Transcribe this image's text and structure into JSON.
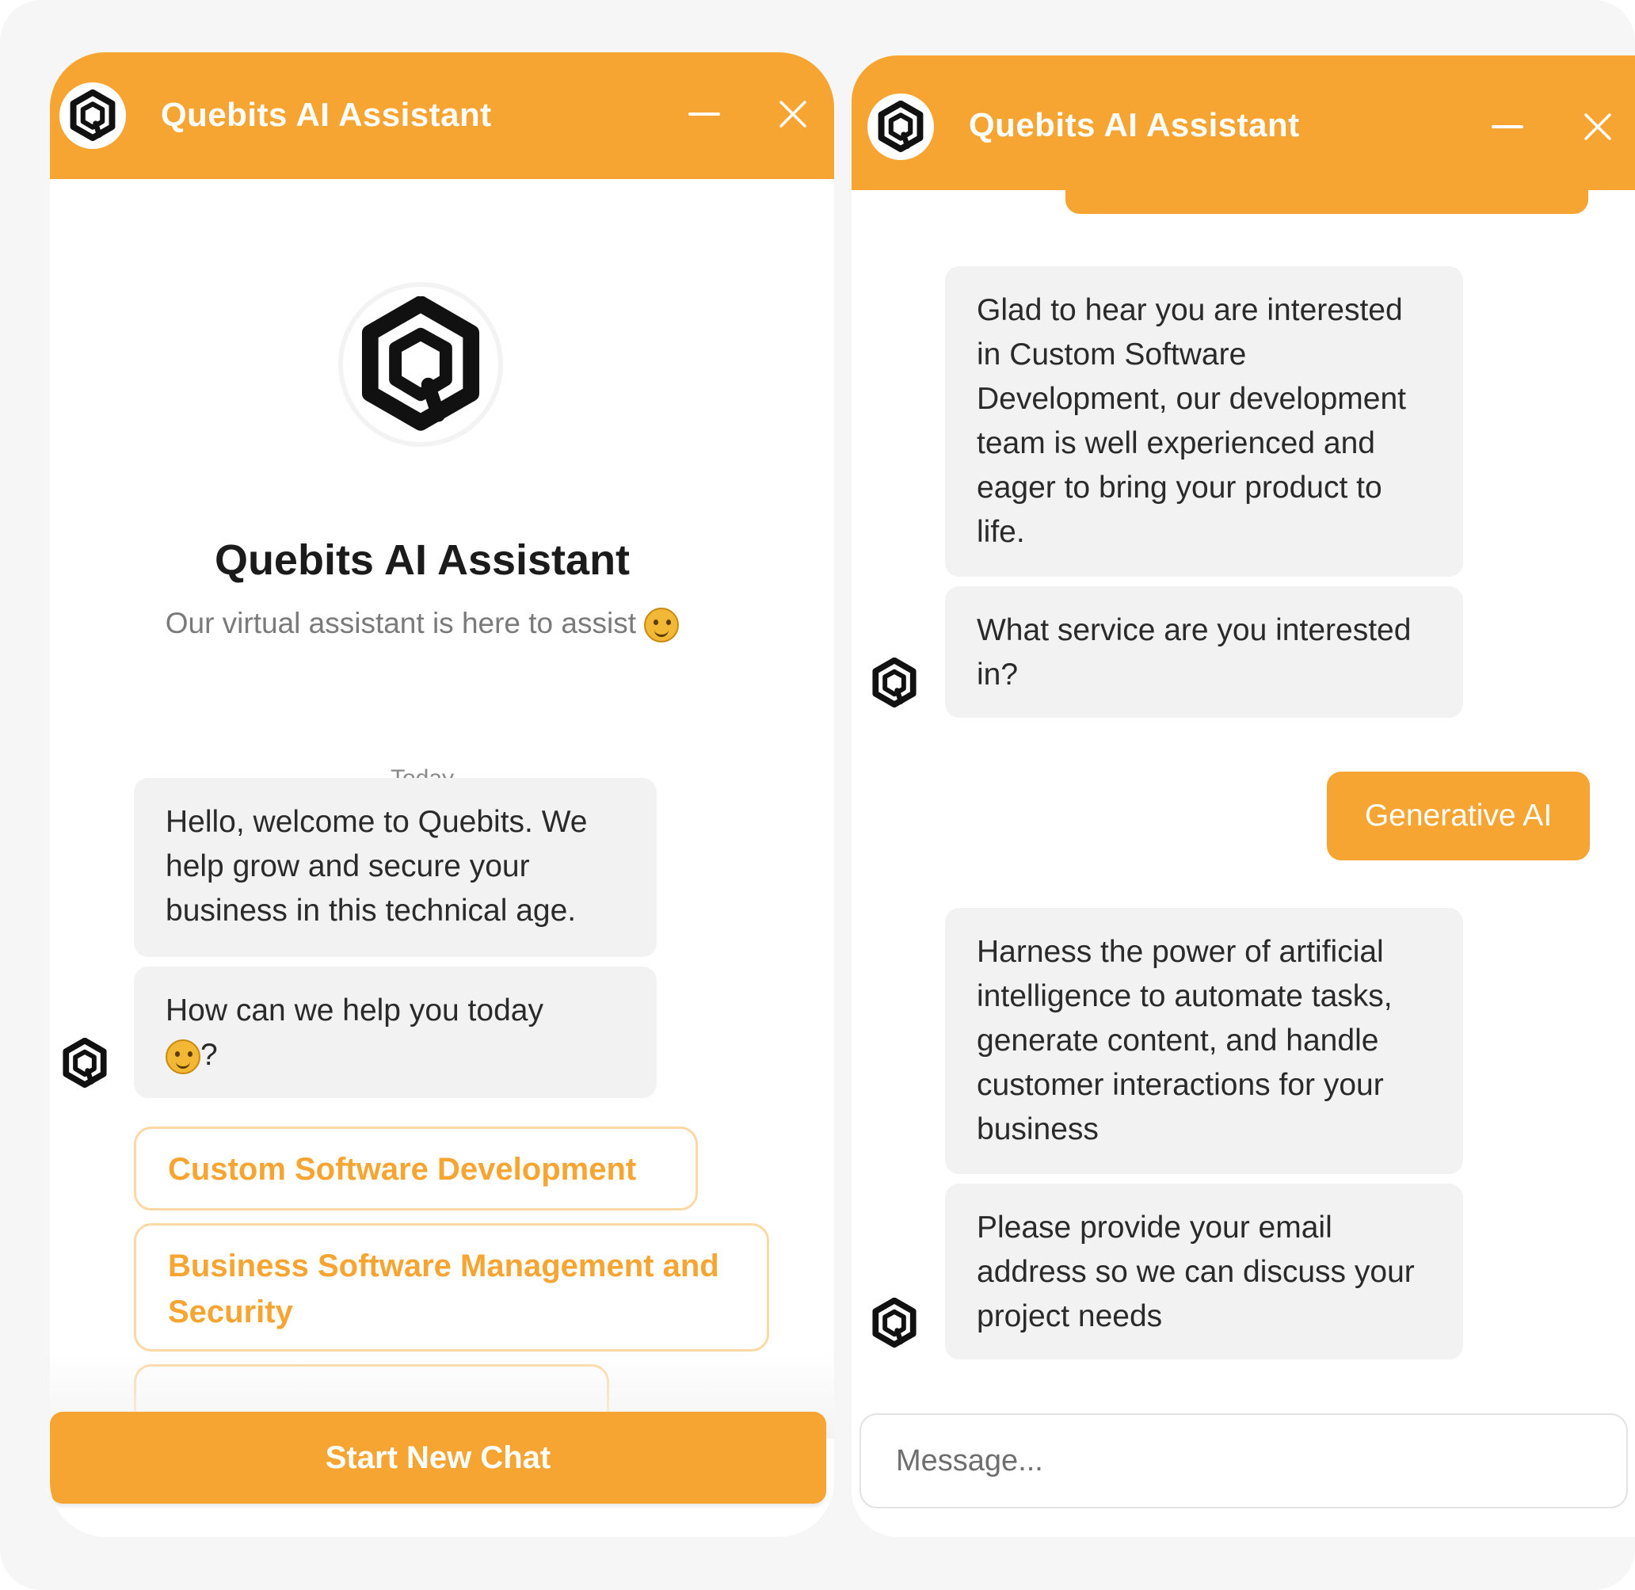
{
  "brand": {
    "accent": "#f6a532",
    "bubble_bg": "#f2f2f2",
    "option_border": "#fbd8a4"
  },
  "left_panel": {
    "header": {
      "title": "Quebits AI Assistant",
      "minimize_icon": "minimize-icon",
      "close_icon": "close-icon"
    },
    "hero": {
      "title": "Quebits AI Assistant",
      "subtitle": "Our virtual assistant is here to assist",
      "emoji": "smiling-face-emoji"
    },
    "date_divider": "Today",
    "messages": [
      {
        "text": "Hello, welcome to Quebits. We help grow and secure your business in this technical age."
      },
      {
        "text": "How can we help you today",
        "suffix": "?"
      }
    ],
    "options": [
      "Custom Software Development",
      "Business Software Management and Security"
    ],
    "start_button": "Start New Chat"
  },
  "right_panel": {
    "header": {
      "title": "Quebits AI Assistant",
      "minimize_icon": "minimize-icon",
      "close_icon": "close-icon"
    },
    "messages": [
      {
        "text": "Glad to hear you are interested in Custom Software Development,  our development team is well experienced and eager to bring your product to life."
      },
      {
        "text": "What service are you interested in?"
      }
    ],
    "user_message": "Generative AI",
    "replies": [
      {
        "text": "Harness the power of artificial intelligence to automate tasks, generate content, and handle customer interactions for your business"
      },
      {
        "text": "Please provide your email address so we can discuss your project needs"
      }
    ],
    "input": {
      "placeholder": "Message..."
    }
  }
}
